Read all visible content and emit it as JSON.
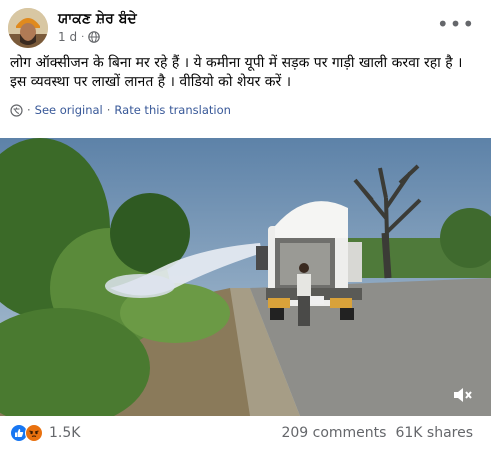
{
  "post": {
    "author": "ਯਾਕਣ ਸ਼ੇਰ ਬੰਦੇ",
    "time": "1 d",
    "privacy_icon": "globe-icon",
    "more_icon": "more-options-icon",
    "text": "लोग ऑक्सीजन के बिना मर रहे हैं । ये कमीना यूपी में सड़क पर गाड़ी खाली करवा रहा है । इस व्यवस्था पर लाखों लानत है । वीडियो को शेयर करें ।",
    "see_original": "See original",
    "separator": "·",
    "rate_translation": "Rate this translation"
  },
  "video": {
    "mute_icon": "speaker-muted-icon"
  },
  "footer": {
    "reaction_count": "1.5K",
    "comments": "209 comments",
    "shares": "61K shares",
    "reaction_icons": [
      "like-icon",
      "angry-icon"
    ],
    "colors": {
      "like": "#1877f2",
      "angry": "#e9710f",
      "link": "#385898",
      "muted_text": "#65676b"
    }
  }
}
